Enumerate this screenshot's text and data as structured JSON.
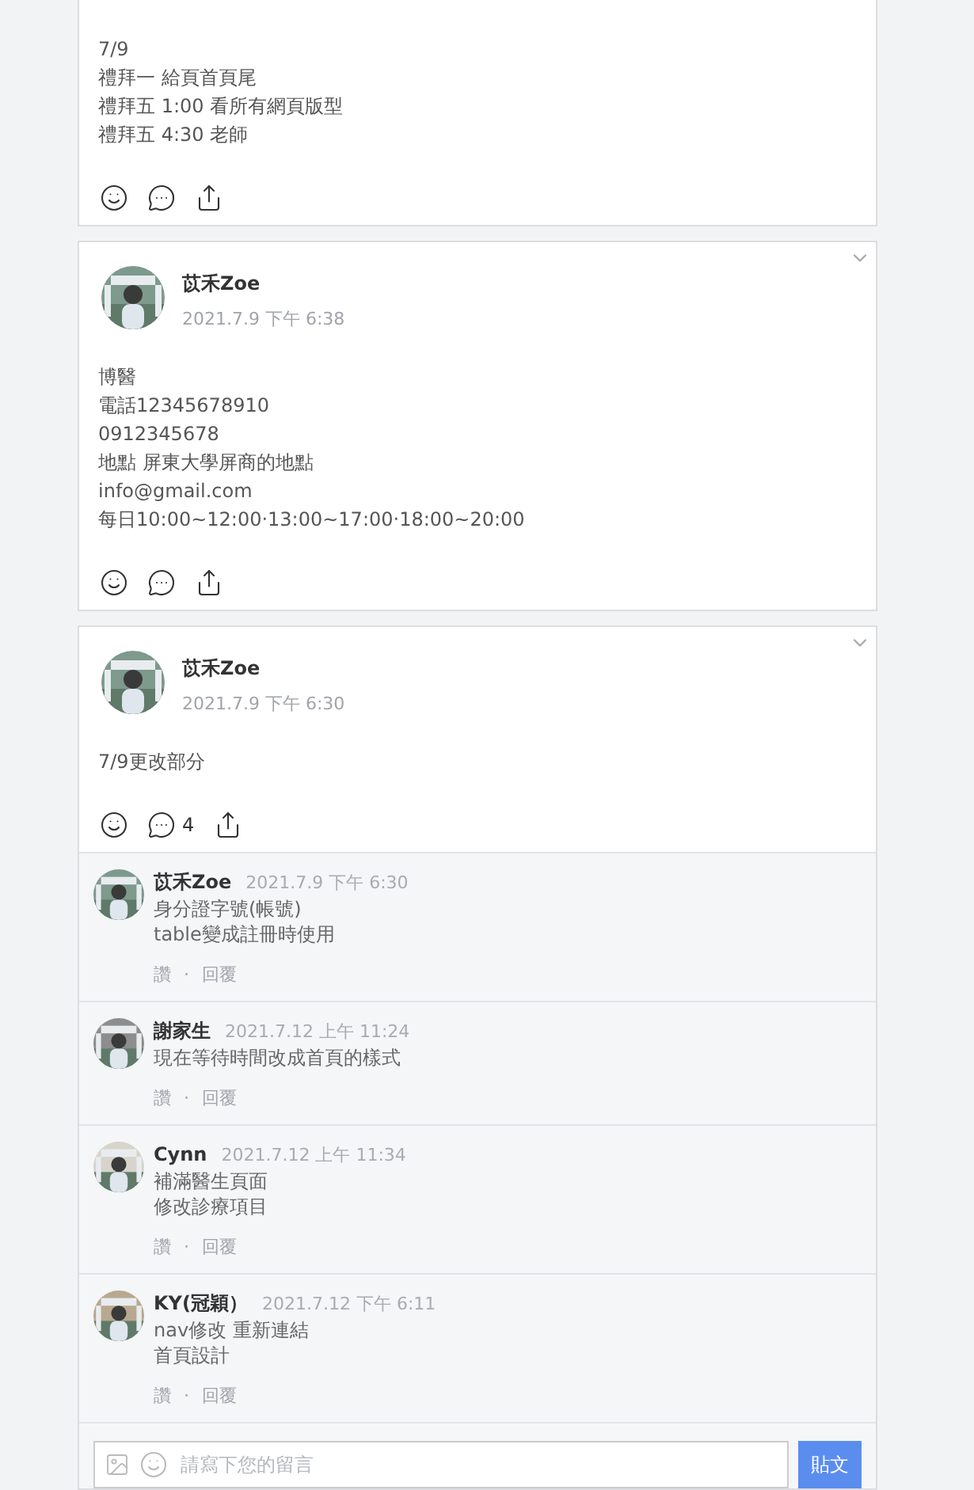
{
  "posts": [
    {
      "body": [
        "7/9",
        "禮拜一 給頁首頁尾",
        "禮拜五 1:00 看所有網頁版型",
        "禮拜五 4:30 老師"
      ]
    },
    {
      "author": "苡禾Zoe",
      "time": "2021.7.9 下午 6:38",
      "body": [
        "博醫",
        "電話12345678910",
        "0912345678",
        "地點 屏東大學屏商的地點",
        "info@gmail.com",
        "每日10:00~12:00‧13:00~17:00‧18:00~20:00"
      ]
    },
    {
      "author": "苡禾Zoe",
      "time": "2021.7.9 下午 6:30",
      "body": [
        "7/9更改部分"
      ],
      "comment_count": "4",
      "comments": [
        {
          "author": "苡禾Zoe",
          "time": "2021.7.9 下午 6:30",
          "lines": [
            "身分證字號(帳號)",
            "table變成註冊時使用"
          ],
          "like": "讚",
          "separator": "·",
          "reply": "回覆"
        },
        {
          "author": "謝家生",
          "time": "2021.7.12 上午 11:24",
          "lines": [
            "現在等待時間改成首頁的樣式"
          ],
          "like": "讚",
          "separator": "·",
          "reply": "回覆"
        },
        {
          "author": "Cynn",
          "time": "2021.7.12 上午 11:34",
          "lines": [
            "補滿醫生頁面",
            "修改診療項目"
          ],
          "like": "讚",
          "separator": "·",
          "reply": "回覆"
        },
        {
          "author": "KY(冠穎）",
          "time": "2021.7.12 下午 6:11",
          "lines": [
            "nav修改 重新連結",
            "首頁設計"
          ],
          "like": "讚",
          "separator": "·",
          "reply": "回覆"
        }
      ],
      "composer": {
        "placeholder": "請寫下您的留言",
        "submit": "貼文"
      }
    }
  ]
}
